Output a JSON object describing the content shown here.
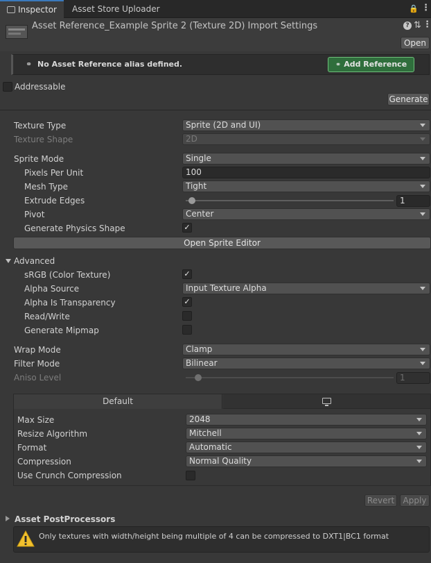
{
  "tabs": [
    {
      "label": "Inspector"
    },
    {
      "label": "Asset Store Uploader"
    }
  ],
  "header": {
    "title": "Asset Reference_Example Sprite 2 (Texture 2D) Import Settings",
    "open_label": "Open"
  },
  "addressables": {
    "alias_message": "No Asset Reference alias defined.",
    "add_reference_label": "Add Reference",
    "addressable_label": "Addressable",
    "addressable_checked": false,
    "generate_label": "Generate",
    "accent_color": "#2f6e3c"
  },
  "settings": {
    "texture_type": {
      "label": "Texture Type",
      "value": "Sprite (2D and UI)"
    },
    "texture_shape": {
      "label": "Texture Shape",
      "value": "2D"
    },
    "sprite_mode": {
      "label": "Sprite Mode",
      "value": "Single"
    },
    "pixels_per_unit": {
      "label": "Pixels Per Unit",
      "value": "100"
    },
    "mesh_type": {
      "label": "Mesh Type",
      "value": "Tight"
    },
    "extrude_edges": {
      "label": "Extrude Edges",
      "value": "1"
    },
    "pivot": {
      "label": "Pivot",
      "value": "Center"
    },
    "generate_physics_shape": {
      "label": "Generate Physics Shape",
      "checked": true
    },
    "open_sprite_editor_label": "Open Sprite Editor"
  },
  "advanced": {
    "label": "Advanced",
    "srgb": {
      "label": "sRGB (Color Texture)",
      "checked": true
    },
    "alpha_source": {
      "label": "Alpha Source",
      "value": "Input Texture Alpha"
    },
    "alpha_is_transparency": {
      "label": "Alpha Is Transparency",
      "checked": true
    },
    "read_write": {
      "label": "Read/Write",
      "checked": false
    },
    "generate_mipmap": {
      "label": "Generate Mipmap",
      "checked": false
    }
  },
  "wrap_mode": {
    "label": "Wrap Mode",
    "value": "Clamp"
  },
  "filter_mode": {
    "label": "Filter Mode",
    "value": "Bilinear"
  },
  "aniso_level": {
    "label": "Aniso Level",
    "value": "1"
  },
  "platform": {
    "default_tab_label": "Default",
    "max_size": {
      "label": "Max Size",
      "value": "2048"
    },
    "resize_algorithm": {
      "label": "Resize Algorithm",
      "value": "Mitchell"
    },
    "format": {
      "label": "Format",
      "value": "Automatic"
    },
    "compression": {
      "label": "Compression",
      "value": "Normal Quality"
    },
    "use_crunch": {
      "label": "Use Crunch Compression",
      "checked": false
    }
  },
  "footer": {
    "revert_label": "Revert",
    "apply_label": "Apply",
    "postprocessors_label": "Asset PostProcessors",
    "warning_message": "Only textures with width/height being multiple of 4 can be compressed to DXT1|BC1 format"
  }
}
